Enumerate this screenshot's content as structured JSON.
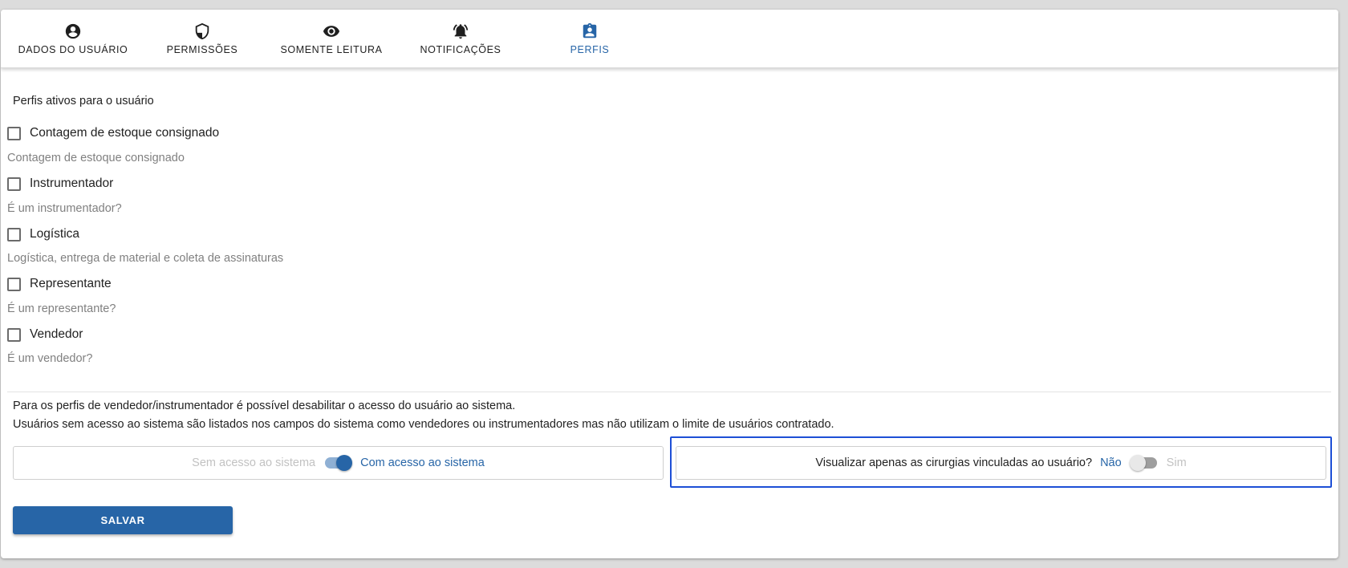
{
  "tabs": [
    {
      "label": "DADOS DO USUÁRIO",
      "icon": "account-circle-icon"
    },
    {
      "label": "PERMISSÕES",
      "icon": "shield-icon"
    },
    {
      "label": "SOMENTE LEITURA",
      "icon": "eye-icon"
    },
    {
      "label": "NOTIFICAÇÕES",
      "icon": "alarm-bell-icon"
    },
    {
      "label": "PERFIS",
      "icon": "profile-badge-icon",
      "active": true
    }
  ],
  "profiles": {
    "title": "Perfis ativos para o usuário",
    "items": [
      {
        "label": "Contagem de estoque consignado",
        "description": "Contagem de estoque consignado",
        "checked": false
      },
      {
        "label": "Instrumentador",
        "description": "É um instrumentador?",
        "checked": false
      },
      {
        "label": "Logística",
        "description": "Logística, entrega de material e coleta de assinaturas",
        "checked": false
      },
      {
        "label": "Representante",
        "description": "É um representante?",
        "checked": false
      },
      {
        "label": "Vendedor",
        "description": "É um vendedor?",
        "checked": false
      }
    ]
  },
  "access_info": {
    "line1": "Para os perfis de vendedor/instrumentador é possível desabilitar o acesso do usuário ao sistema.",
    "line2": "Usuários sem acesso ao sistema são listados nos campos do sistema como vendedores ou instrumentadores mas não utilizam o limite de usuários contratado."
  },
  "access_toggle": {
    "off_label": "Sem acesso ao sistema",
    "on_label": "Com acesso ao sistema",
    "value": true
  },
  "surgery_toggle": {
    "question": "Visualizar apenas as cirurgias vinculadas ao usuário?",
    "no_label": "Não",
    "yes_label": "Sim",
    "value": false
  },
  "actions": {
    "save_label": "SALVAR"
  },
  "colors": {
    "accent": "#2765a7",
    "focus": "#1d4fd6",
    "muted_text": "#808080"
  }
}
